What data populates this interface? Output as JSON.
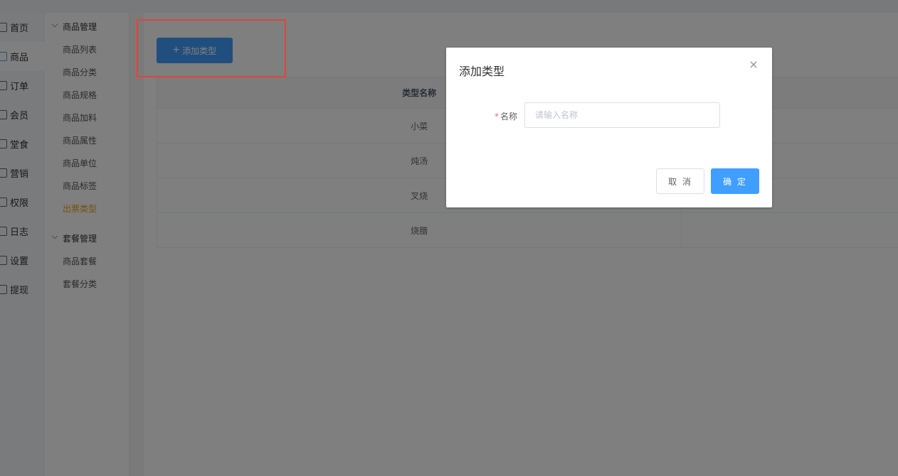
{
  "colors": {
    "primary": "#409eff",
    "active_link": "#f0a020",
    "highlight": "#e0443c",
    "required": "#f56c6c"
  },
  "primary_nav": [
    {
      "label": "首页",
      "icon": "home-icon"
    },
    {
      "label": "商品",
      "icon": "goods-icon",
      "active": true
    },
    {
      "label": "订单",
      "icon": "order-icon"
    },
    {
      "label": "会员",
      "icon": "member-icon"
    },
    {
      "label": "堂食",
      "icon": "dine-in-icon"
    },
    {
      "label": "营销",
      "icon": "marketing-icon"
    },
    {
      "label": "权限",
      "icon": "lock-icon"
    },
    {
      "label": "日志",
      "icon": "log-icon"
    },
    {
      "label": "设置",
      "icon": "settings-icon"
    },
    {
      "label": "提现",
      "icon": "withdraw-icon"
    }
  ],
  "secondary_nav": {
    "group1": "商品管理",
    "group1_items": [
      "商品列表",
      "商品分类",
      "商品规格",
      "商品加料",
      "商品属性",
      "商品单位",
      "商品标签",
      "出票类型"
    ],
    "group2": "套餐管理",
    "group2_items": [
      "商品套餐",
      "套餐分类"
    ],
    "active_item": "出票类型"
  },
  "toolbar": {
    "add_label": "添加类型"
  },
  "table": {
    "header": "类型名称",
    "rows": [
      "小菜",
      "炖汤",
      "叉烧",
      "烧腊"
    ]
  },
  "dialog": {
    "title": "添加类型",
    "field_label": "名称",
    "field_placeholder": "请输入名称",
    "cancel_label": "取 消",
    "ok_label": "确 定"
  }
}
